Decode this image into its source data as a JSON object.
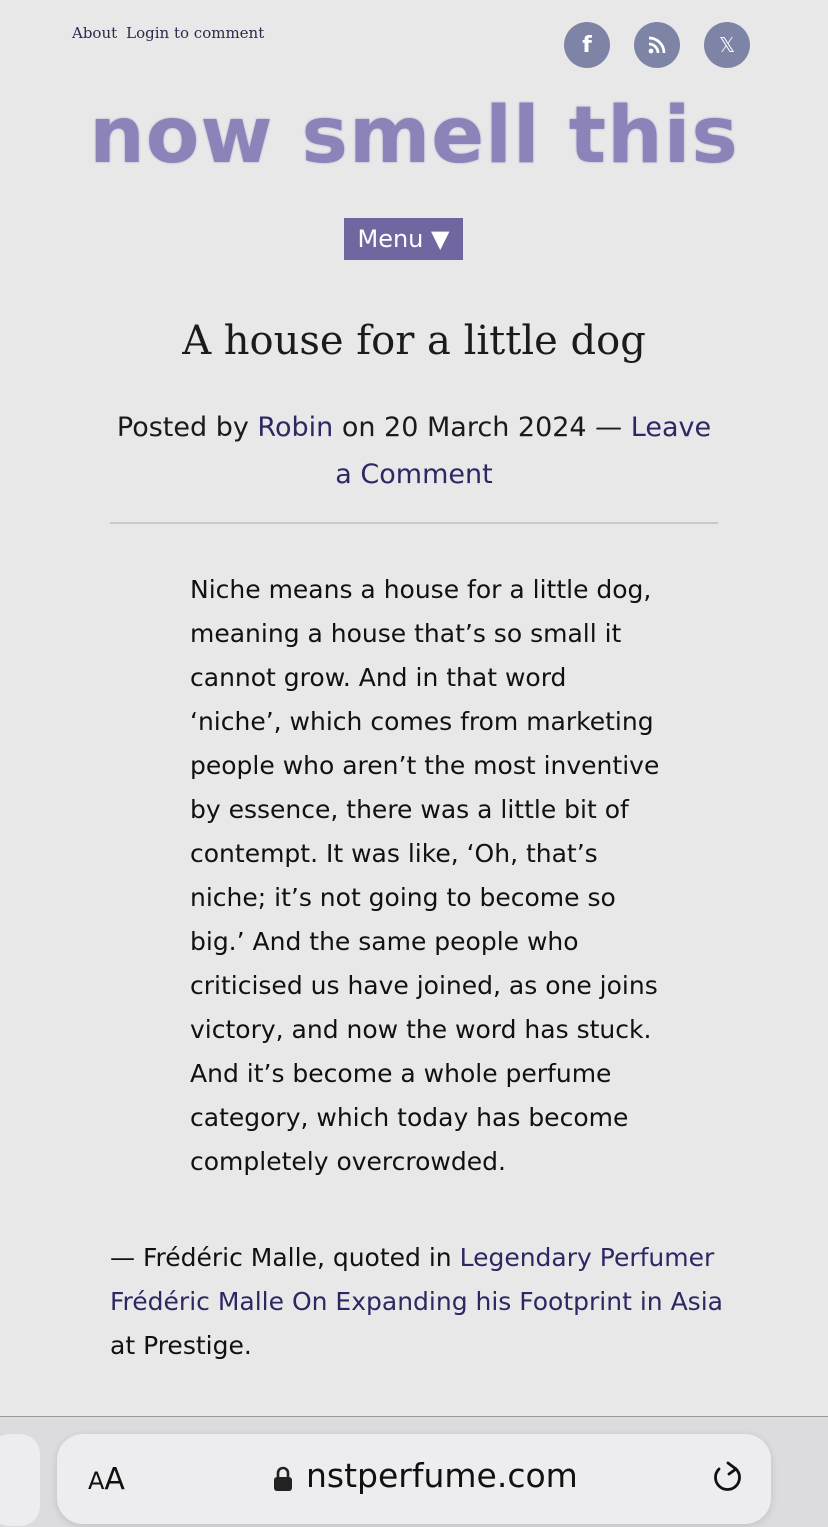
{
  "header": {
    "links": [
      "About",
      "Login to comment"
    ],
    "social": [
      {
        "icon": "facebook-icon",
        "glyph": "f"
      },
      {
        "icon": "rss-icon",
        "glyph": ""
      },
      {
        "icon": "x-icon",
        "glyph": "𝕏"
      }
    ],
    "logo_text": "now smell this",
    "menu_label": "Menu ▼"
  },
  "post": {
    "title": "A house for a little dog",
    "meta_prefix": "Posted by",
    "author": "Robin",
    "meta_on": "on 20 March 2024 —",
    "comment_link": "Leave a Comment",
    "quote": "Niche means a house for a little dog, meaning a house that’s so small it cannot grow. And in that word ‘niche’, which comes from marketing people who aren’t the most inventive by essence, there was a little bit of contempt. It was like, ‘Oh, that’s niche; it’s not going to become so big.’ And the same people who criticised us have joined, as one joins victory, and now the word has stuck. And it’s become a whole perfume category, which today has become completely overcrowded.",
    "attrib_prefix": "— Frédéric Malle, quoted in",
    "attrib_link": "Legendary Perfumer Frédéric Malle On Expanding his Footprint in Asia",
    "attrib_suffix": "at Prestige."
  },
  "browser": {
    "aa_label_small": "A",
    "aa_label_large": "A",
    "domain": "nstperfume.com"
  },
  "colors": {
    "accent": "#7067a1",
    "link": "#2c2863",
    "social_bg": "#7d84a6",
    "logo": "#8c84b8",
    "background": "#e8e8e9"
  }
}
